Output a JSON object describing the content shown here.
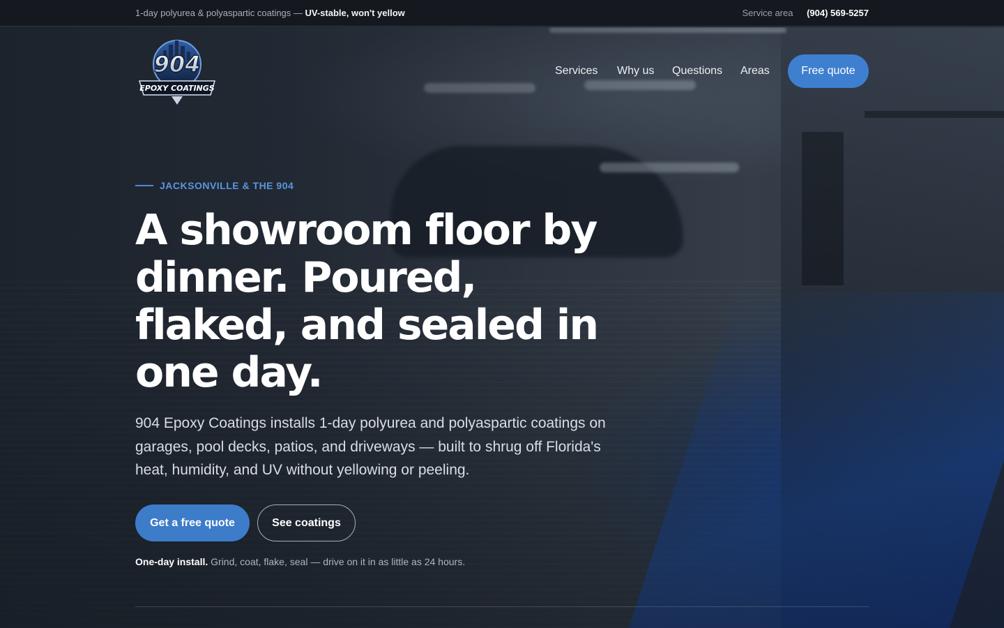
{
  "topbar": {
    "tagline": "1-day polyurea & polyaspartic coatings — ",
    "tagline_strong": "UV-stable, won't yellow",
    "service_area_label": "Service area",
    "phone": "(904) 569-5257"
  },
  "logo": {
    "number": "904",
    "name": "EPOXY COATINGS"
  },
  "nav": {
    "items": [
      "Services",
      "Why us",
      "Questions",
      "Areas"
    ],
    "cta": "Free quote"
  },
  "hero": {
    "eyebrow": "JACKSONVILLE & THE 904",
    "headline": "A showroom floor by dinner. Poured, flaked, and sealed in one day.",
    "subtext": "904 Epoxy Coatings installs 1-day polyurea and polyaspartic coatings on garages, pool decks, patios, and driveways — built to shrug off Florida's heat, humidity, and UV without yellowing or peeling.",
    "primary_button": "Get a free quote",
    "secondary_button": "See coatings",
    "note_strong": "One-day install.",
    "note_text": " Grind, coat, flake, seal — drive on it in as little as 24 hours."
  },
  "colors": {
    "accent": "#3f7fd0",
    "eyebrow": "#5b95e0",
    "topbar_bg": "#15191f"
  }
}
